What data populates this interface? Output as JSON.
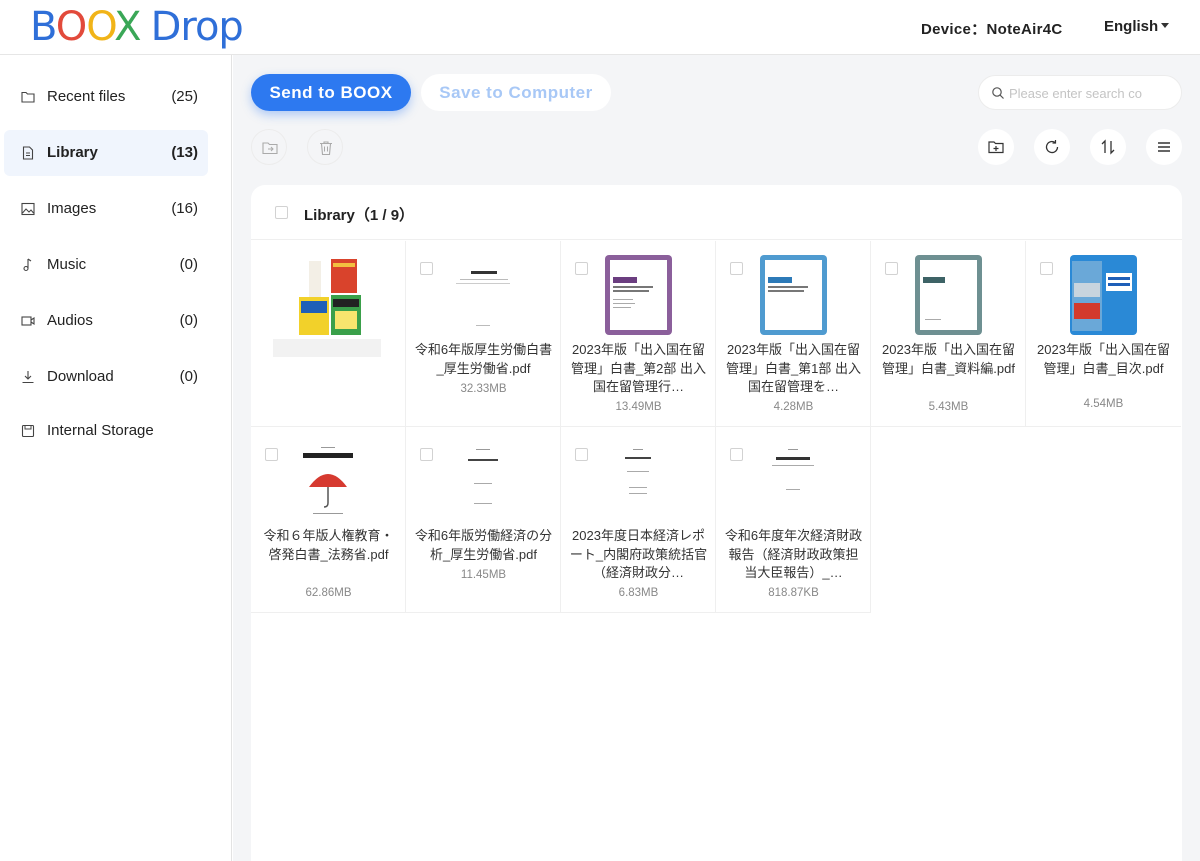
{
  "header": {
    "logo": {
      "b": "B",
      "o1": "O",
      "o2": "O",
      "x": "X",
      "drop": "Drop"
    },
    "device_label": "Device：NoteAir4C",
    "language": "English"
  },
  "sidebar": {
    "items": [
      {
        "label": "Recent files",
        "count": "(25)",
        "icon": "folder-icon"
      },
      {
        "label": "Library",
        "count": "(13)",
        "icon": "document-icon"
      },
      {
        "label": "Images",
        "count": "(16)",
        "icon": "image-icon"
      },
      {
        "label": "Music",
        "count": "(0)",
        "icon": "music-note-icon"
      },
      {
        "label": "Audios",
        "count": "(0)",
        "icon": "video-icon"
      },
      {
        "label": "Download",
        "count": "(0)",
        "icon": "download-icon"
      },
      {
        "label": "Internal Storage",
        "count": "",
        "icon": "storage-icon"
      }
    ],
    "active": "Library"
  },
  "toolbar": {
    "send_label": "Send to BOOX",
    "save_label": "Save to Computer",
    "search_placeholder": "Please enter search co"
  },
  "colors": {
    "accent": "#2d79f0",
    "logo_blue": "#2f6fd8",
    "logo_red": "#e24a3b",
    "logo_yellow": "#f1b418",
    "logo_green": "#3aa757"
  },
  "library": {
    "title": "Library（1 / 9）",
    "files": [
      {
        "name": "",
        "size": "",
        "thumb": "books-collage"
      },
      {
        "name": "令和6年版厚生労働白書_厚生労働省.pdf",
        "size": "32.33MB",
        "thumb": "doc-plain"
      },
      {
        "name": "2023年版「出入国在留管理」白書_第2部 出入国在留管理行…",
        "size": "13.49MB",
        "thumb": "cover-purple"
      },
      {
        "name": "2023年版「出入国在留管理」白書_第1部 出入国在留管理を…",
        "size": "4.28MB",
        "thumb": "cover-blue"
      },
      {
        "name": "2023年版「出入国在留管理」白書_資料編.pdf",
        "size": "5.43MB",
        "thumb": "cover-teal"
      },
      {
        "name": "2023年版「出入国在留管理」白書_目次.pdf",
        "size": "4.54MB",
        "thumb": "cover-photo"
      },
      {
        "name": "令和６年版人権教育・啓発白書_法務省.pdf",
        "size": "62.86MB",
        "thumb": "doc-umbrella"
      },
      {
        "name": "令和6年版労働経済の分析_厚生労働省.pdf",
        "size": "11.45MB",
        "thumb": "doc-plain"
      },
      {
        "name": "2023年度日本経済レポート_内閣府政策統括官（経済財政分…",
        "size": "6.83MB",
        "thumb": "doc-plain"
      },
      {
        "name": "令和6年度年次経済財政報告（経済財政政策担当大臣報告）_…",
        "size": "818.87KB",
        "thumb": "doc-plain"
      }
    ]
  }
}
